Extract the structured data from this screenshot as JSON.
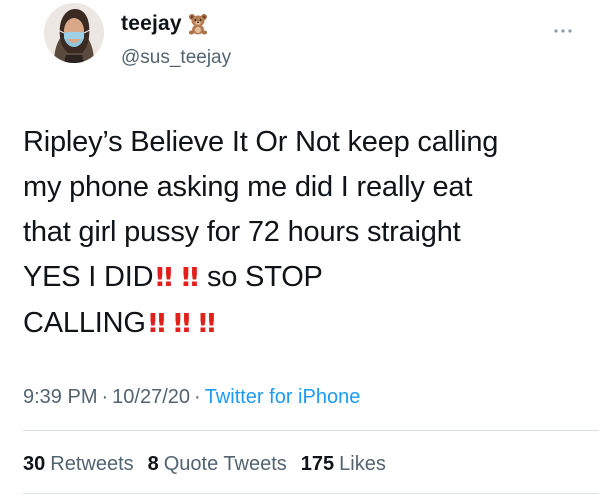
{
  "author": {
    "display_name": "teejay",
    "handle": "@sus_teejay",
    "name_emoji_icon": "teddy-bear-icon",
    "avatar_icon": "profile-photo-avatar"
  },
  "more_icon": "ellipsis-icon",
  "tweet": {
    "lines": [
      "Ripley’s Believe It Or Not keep calling",
      "my phone asking me did I really eat",
      "that girl pussy for 72 hours straight",
      "YES I DID",
      "so STOP",
      "CALLING"
    ],
    "emphasis_glyph": "‼",
    "emphasis_icon": "double-exclamation-icon",
    "emphasis_color": "#e0201b"
  },
  "meta": {
    "time": "9:39 PM",
    "date": "10/27/20",
    "separator": "·",
    "source": "Twitter for iPhone"
  },
  "stats": {
    "retweets_count": "30",
    "retweets_label": "Retweets",
    "quote_tweets_count": "8",
    "quote_tweets_label": "Quote Tweets",
    "likes_count": "175",
    "likes_label": "Likes"
  },
  "colors": {
    "text": "#0f1419",
    "secondary": "#536471",
    "link": "#1d9bf0",
    "divider": "#d9dee2"
  }
}
